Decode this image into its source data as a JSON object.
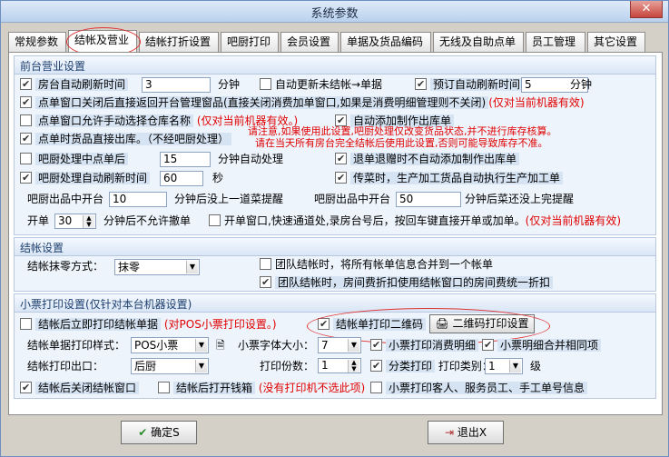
{
  "window": {
    "title": "系统参数",
    "close": "✕"
  },
  "tabs": [
    "常规参数",
    "结帐及营业",
    "结帐打折设置",
    "吧厨打印",
    "会员设置",
    "单据及货品编码",
    "无线及自助点单",
    "员工管理",
    "其它设置"
  ],
  "sec1": {
    "title": "前台营业设置",
    "auto_refresh": "房台自动刷新时间",
    "auto_refresh_val": "3",
    "unit_min": "分钟",
    "auto_update_unpaid": "自动更新未结帐→单据",
    "reserve_refresh": "预订自动刷新时间",
    "reserve_refresh_val": "5",
    "close_return": "点单窗口关闭后直接返回开台管理窗品(直接关闭消费加单窗口,如果是消费明细管理则不关闭)",
    "this_machine": "(仅对当前机器有效)",
    "allow_manual_store": "点单窗口允许手动选择仓库名称",
    "this_machine2": "(仅对当前机器有效。)",
    "auto_outbound": "自动添加制作出库单",
    "direct_outbound": "点单时货品直接出库。（不经吧厨处理）",
    "warning1": "请注意,如果使用此设置,吧厨处理仅改变货品状态,并不进行库存核算。",
    "warning2": "请在当天所有房台完全结帐后使用此设置,否则可能导致库存不准。",
    "in_process": "吧厨处理中点单后",
    "in_process_val": "15",
    "auto_process": "分钟自动处理",
    "return_no_outbound": "退单退赠时不自动添加制作出库单",
    "kitchen_refresh": "吧厨处理自动刷新时间",
    "kitchen_refresh_val": "60",
    "unit_sec": "秒",
    "auto_produce": "传菜时，生产加工货品自动执行生产加工单",
    "mid_table": "吧厨出品中开台",
    "mid_table_val": "10",
    "remind_next": "分钟后没上一道菜提醒",
    "mid_table2": "吧厨出品中开台",
    "mid_table2_val": "50",
    "remind_done": "分钟后菜还没上完提醒",
    "open_table": "开单",
    "open_table_val": "30",
    "no_cancel": "分钟后不允许撤单",
    "quick_open": "开单窗口,快速通道处,录房台号后，按回车键直接开单或加单。",
    "this_machine3": "(仅对当前机器有效)"
  },
  "sec2": {
    "title": "结帐设置",
    "rounding_label": "结帐抹零方式：",
    "rounding_val": "抹零",
    "merge_bills": "团队结帐时，将所有帐单信息合并到一个帐单",
    "room_discount": "团队结帐时，房间费折扣使用结帐窗口的房间费统一折扣"
  },
  "sec3": {
    "title": "小票打印设置(仅针对本台机器设置)",
    "print_after": "结帐后立即打印结帐单据",
    "pos_note": "(对POS小票打印设置。)",
    "print_qr": "结帐单打印二维码",
    "qr_settings": "二维码打印设置",
    "style_label": "结帐单据打印样式：",
    "style_val": "POS小票",
    "font_label": "小票字体大小：",
    "font_val": "7",
    "print_detail": "小票打印消费明细",
    "merge_same": "小票明细合并相同项",
    "out_label": "结帐打印出口：",
    "out_val": "后厨",
    "copies_label": "打印份数：",
    "copies_val": "1",
    "class_print": "分类打印",
    "print_cat_label": "打印类别：",
    "print_cat_val": "1",
    "level": "级",
    "close_after": "结帐后关闭结帐窗口",
    "open_drawer": "结帐后打开钱箱",
    "no_printer": "(没有打印机不选此项)",
    "print_guest": "小票打印客人、服务员工、手工单号信息"
  },
  "buttons": {
    "ok": "确定S",
    "exit": "退出X"
  }
}
